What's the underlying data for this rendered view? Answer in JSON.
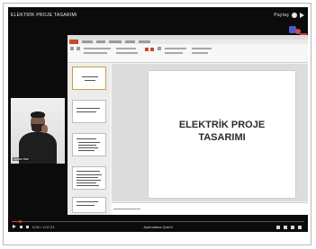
{
  "video": {
    "title": "ELEKTRİK PROJE TASARIMI",
    "top_right_label": "Paylaş",
    "time": "0:00 / 1:07:21",
    "chapter": "Aydınlatma Çizimi"
  },
  "slide": {
    "line1": "ELEKTRİK PROJE",
    "line2": "TASARIMI"
  },
  "webcam": {
    "name": "Ayhan Atal"
  },
  "progress": {
    "fraction": 0.03
  },
  "colors": {
    "player_bg": "#0b0b0b",
    "progress": "#e53935",
    "office_accent": "#c84a24"
  },
  "icons": [
    "play-icon",
    "next-icon",
    "volume-icon",
    "settings-icon",
    "fullscreen-icon",
    "share-icon",
    "watch-later-icon"
  ]
}
